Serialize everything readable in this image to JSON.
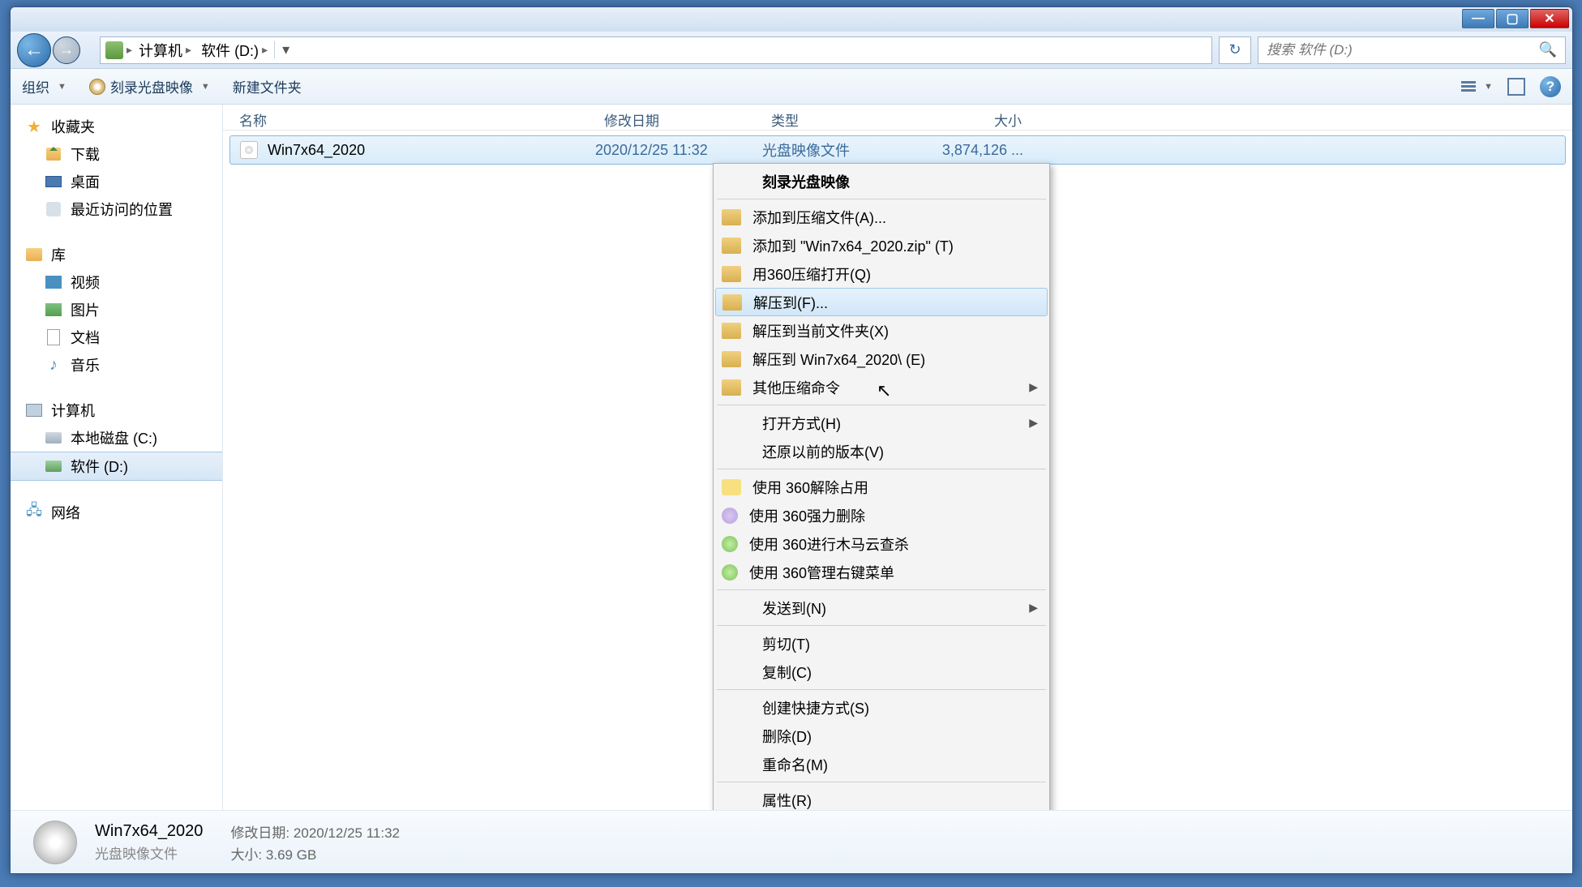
{
  "breadcrumb": {
    "seg1": "计算机",
    "seg2": "软件 (D:)"
  },
  "search": {
    "placeholder": "搜索 软件 (D:)"
  },
  "toolbar": {
    "organize": "组织",
    "burn": "刻录光盘映像",
    "newfolder": "新建文件夹"
  },
  "sidebar": {
    "favorites": "收藏夹",
    "downloads": "下载",
    "desktop": "桌面",
    "recent": "最近访问的位置",
    "libraries": "库",
    "videos": "视频",
    "pictures": "图片",
    "documents": "文档",
    "music": "音乐",
    "computer": "计算机",
    "drive_c": "本地磁盘 (C:)",
    "drive_d": "软件 (D:)",
    "network": "网络"
  },
  "columns": {
    "name": "名称",
    "date": "修改日期",
    "type": "类型",
    "size": "大小"
  },
  "file": {
    "name": "Win7x64_2020",
    "date": "2020/12/25 11:32",
    "type": "光盘映像文件",
    "size": "3,874,126 ..."
  },
  "context": {
    "burn": "刻录光盘映像",
    "add_archive": "添加到压缩文件(A)...",
    "add_zip": "添加到 \"Win7x64_2020.zip\" (T)",
    "open_360": "用360压缩打开(Q)",
    "extract_to": "解压到(F)...",
    "extract_here": "解压到当前文件夹(X)",
    "extract_folder": "解压到 Win7x64_2020\\ (E)",
    "other_compress": "其他压缩命令",
    "open_with": "打开方式(H)",
    "restore": "还原以前的版本(V)",
    "unlock_360": "使用 360解除占用",
    "force_del_360": "使用 360强力删除",
    "scan_360": "使用 360进行木马云查杀",
    "manage_360": "使用 360管理右键菜单",
    "send_to": "发送到(N)",
    "cut": "剪切(T)",
    "copy": "复制(C)",
    "shortcut": "创建快捷方式(S)",
    "delete": "删除(D)",
    "rename": "重命名(M)",
    "properties": "属性(R)"
  },
  "status": {
    "title": "Win7x64_2020",
    "subtitle": "光盘映像文件",
    "date_label": "修改日期:",
    "date_value": "2020/12/25 11:32",
    "size_label": "大小:",
    "size_value": "3.69 GB"
  }
}
